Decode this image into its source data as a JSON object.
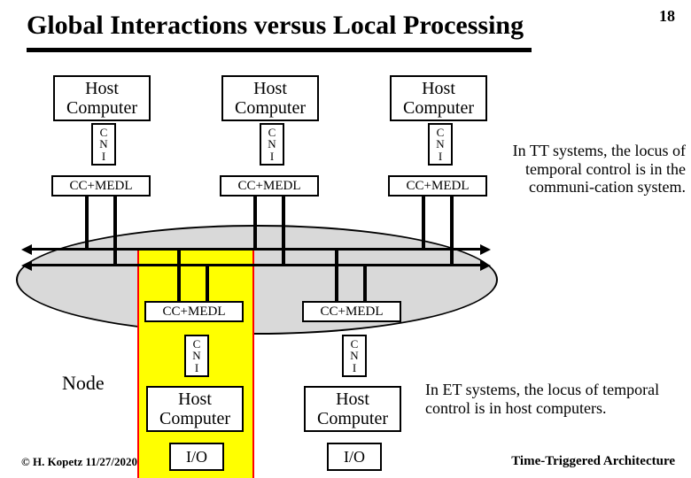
{
  "page_number": "18",
  "title": "Global Interactions versus Local Processing",
  "labels": {
    "host": "Host\nComputer",
    "cni": "C\nN\nI",
    "ccmedl": "CC+MEDL",
    "io": "I/O",
    "node": "Node"
  },
  "captions": {
    "tt": "In TT systems, the locus of temporal control is in the communi-cation system.",
    "et": "In ET systems, the locus of temporal control is in host computers."
  },
  "footer": {
    "left": "© H. Kopetz  11/27/2020",
    "right": "Time-Triggered Architecture"
  }
}
